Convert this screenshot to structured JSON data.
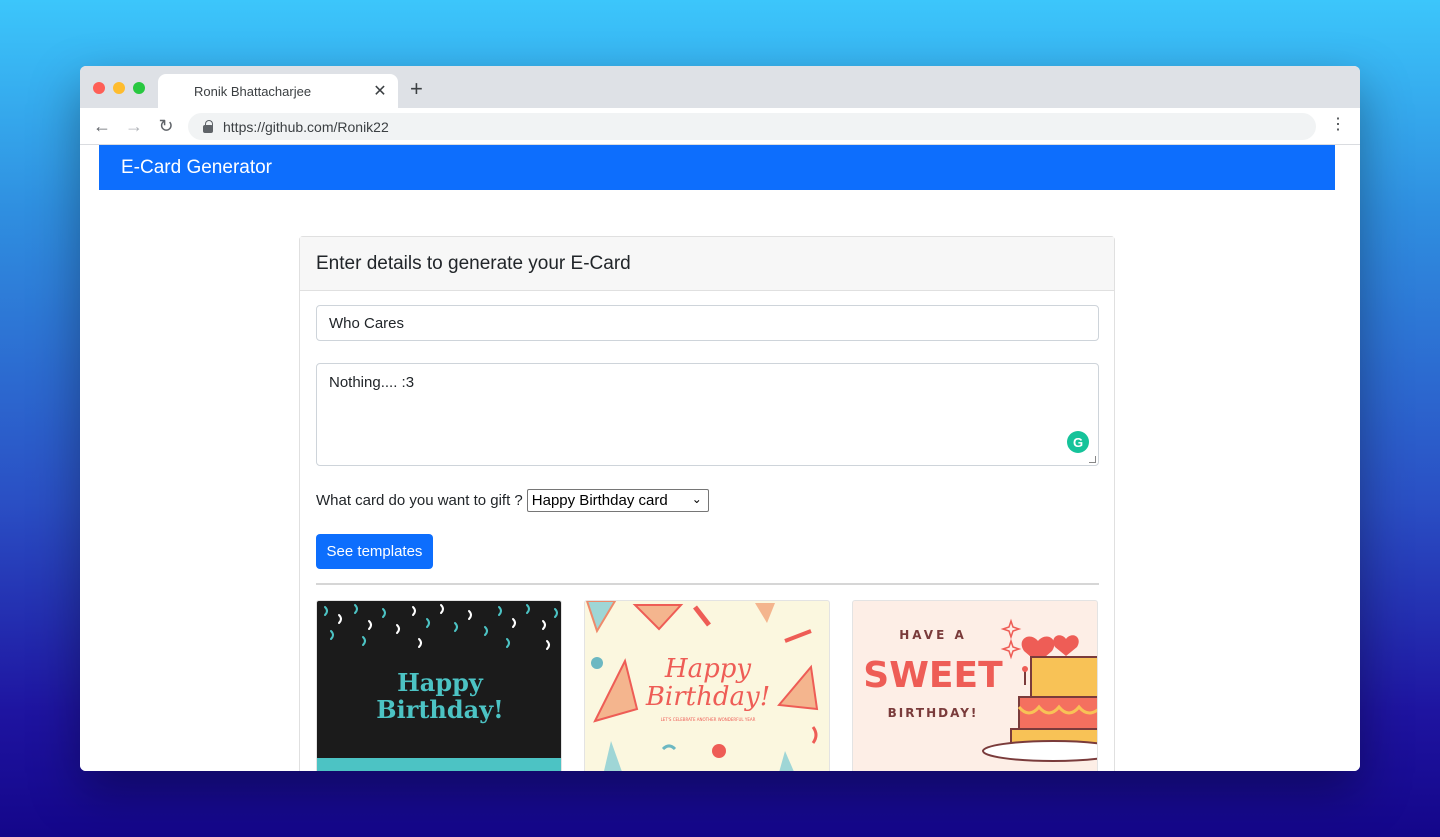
{
  "browser": {
    "tab_title": "Ronik Bhattacharjee",
    "tab_close": "✕",
    "new_tab": "+",
    "url": "https://github.com/Ronik22",
    "back": "←",
    "forward": "→",
    "reload": "↻",
    "menu": "⋮"
  },
  "navbar": {
    "brand": "E-Card Generator"
  },
  "form": {
    "header": "Enter details to generate your E-Card",
    "name_value": "Who Cares",
    "message_value": "Nothing.... :3",
    "grammarly_glyph": "G",
    "select_label": "What card do you want to gift ?",
    "select_value": "Happy Birthday card",
    "select_chevron": "⌄",
    "submit_label": "See templates"
  },
  "templates": [
    {
      "line1": "Happy",
      "line2": "Birthday!"
    },
    {
      "line1": "Happy",
      "line2": "Birthday!",
      "subline": "LET'S CELEBRATE ANOTHER WONDERFUL YEAR"
    },
    {
      "line1": "HAVE A",
      "line2": "SWEET",
      "line3": "BIRTHDAY!"
    }
  ],
  "colors": {
    "primary": "#0d6efd",
    "teal": "#4cc3c4",
    "coral": "#ee5d56"
  }
}
